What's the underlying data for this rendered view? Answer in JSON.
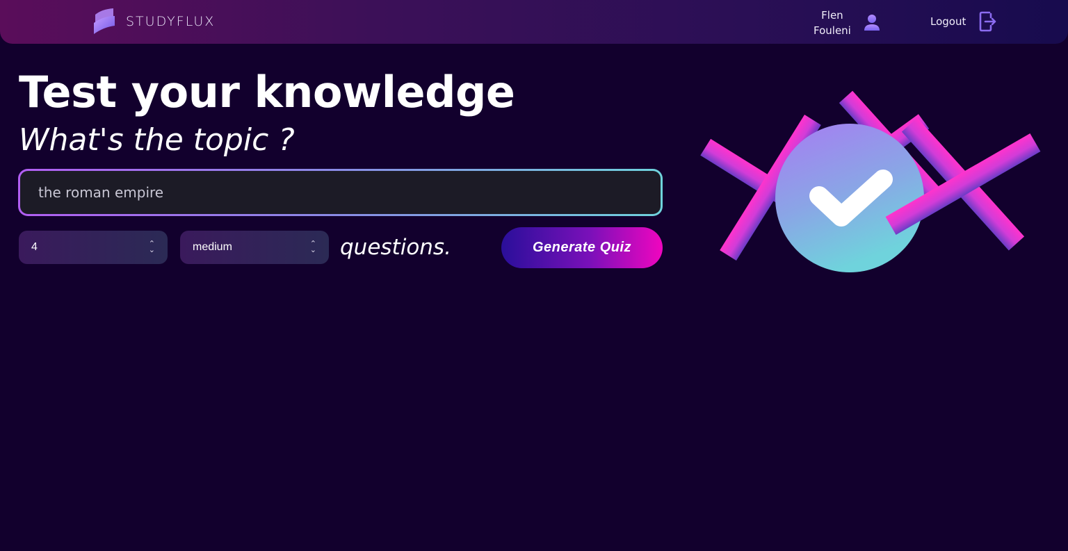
{
  "header": {
    "brand": "STUDYFLUX",
    "user": {
      "first": "Flen",
      "last": "Fouleni"
    },
    "logout_label": "Logout"
  },
  "main": {
    "title": "Test your knowledge",
    "subtitle": "What's the topic ?",
    "topic_input": {
      "value": "the roman empire",
      "placeholder": ""
    },
    "question_count": {
      "selected": "4"
    },
    "difficulty": {
      "selected": "medium"
    },
    "questions_label": "questions.",
    "generate_label": "Generate Quiz"
  },
  "colors": {
    "background": "#12002d",
    "accent_pink": "#ff33cc",
    "accent_purple": "#a77cf2",
    "accent_cyan": "#6fd3dc"
  },
  "icons": [
    "logo-icon",
    "user-icon",
    "logout-icon",
    "chevron-updown-icon",
    "checkmark-icon"
  ]
}
